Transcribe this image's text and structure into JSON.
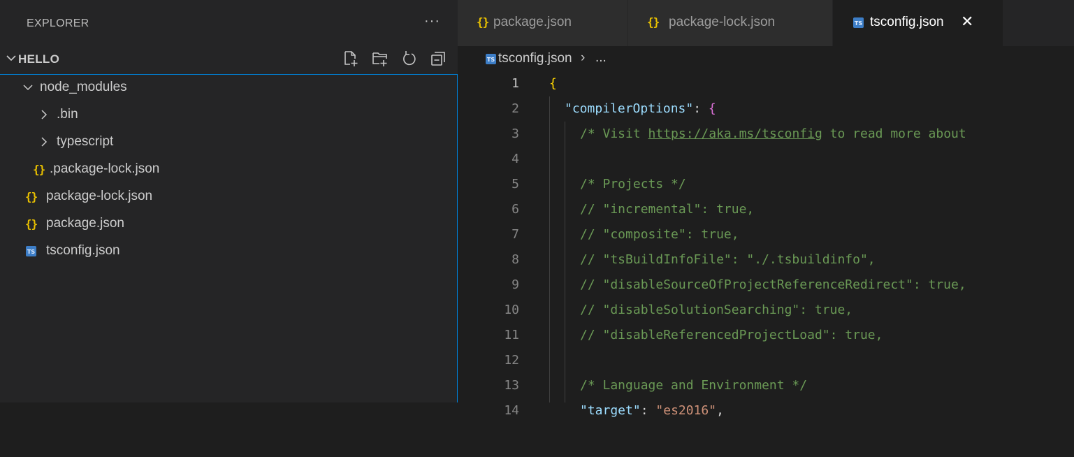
{
  "explorer": {
    "title": "EXPLORER",
    "more_icon": "···",
    "section_title": "HELLO",
    "actions": [
      "new-file-icon",
      "new-folder-icon",
      "refresh-icon",
      "collapse-all-icon"
    ]
  },
  "tree": {
    "items": [
      {
        "label": "node_modules",
        "type": "folder",
        "expanded": true
      },
      {
        "label": ".bin",
        "type": "folder",
        "expanded": false
      },
      {
        "label": "typescript",
        "type": "folder",
        "expanded": false
      },
      {
        "label": ".package-lock.json",
        "type": "json"
      },
      {
        "label": "package-lock.json",
        "type": "json"
      },
      {
        "label": "package.json",
        "type": "json"
      },
      {
        "label": "tsconfig.json",
        "type": "ts"
      }
    ]
  },
  "tabs": [
    {
      "label": "package.json",
      "icon": "{}",
      "active": false
    },
    {
      "label": "package-lock.json",
      "icon": "{}",
      "active": false
    },
    {
      "label": "tsconfig.json",
      "icon": "TS",
      "active": true,
      "close": "✕"
    }
  ],
  "breadcrumbs": {
    "file": "tsconfig.json",
    "separator": "›",
    "more": "..."
  },
  "icons": {
    "json_glyph": "{}",
    "ts_glyph": "TS"
  },
  "editor": {
    "lines": [
      {
        "n": "1",
        "text": "{"
      },
      {
        "n": "2",
        "text": "\"compilerOptions\": {"
      },
      {
        "n": "3",
        "text_a": "/* Visit ",
        "link": "https://aka.ms/tsconfig",
        "text_b": " to read more about"
      },
      {
        "n": "4",
        "text": ""
      },
      {
        "n": "5",
        "text": "/* Projects */"
      },
      {
        "n": "6",
        "text": "// \"incremental\": true,"
      },
      {
        "n": "7",
        "text": "// \"composite\": true,"
      },
      {
        "n": "8",
        "text": "// \"tsBuildInfoFile\": \"./.tsbuildinfo\","
      },
      {
        "n": "9",
        "text": "// \"disableSourceOfProjectReferenceRedirect\": true,"
      },
      {
        "n": "10",
        "text": "// \"disableSolutionSearching\": true,"
      },
      {
        "n": "11",
        "text": "// \"disableReferencedProjectLoad\": true,"
      },
      {
        "n": "12",
        "text": ""
      },
      {
        "n": "13",
        "text": "/* Language and Environment */"
      },
      {
        "n": "14",
        "key": "\"target\"",
        "colon": ": ",
        "value": "\"es2016\"",
        "tail": ","
      }
    ]
  },
  "colors": {
    "sidebar_bg": "#252526",
    "editor_bg": "#1e1e1e",
    "focus_border": "#007fd4",
    "json_icon": "#e8c000",
    "ts_icon": "#3d7ec7",
    "comment": "#6a9955",
    "key": "#9cdcfe",
    "string": "#ce9178"
  }
}
